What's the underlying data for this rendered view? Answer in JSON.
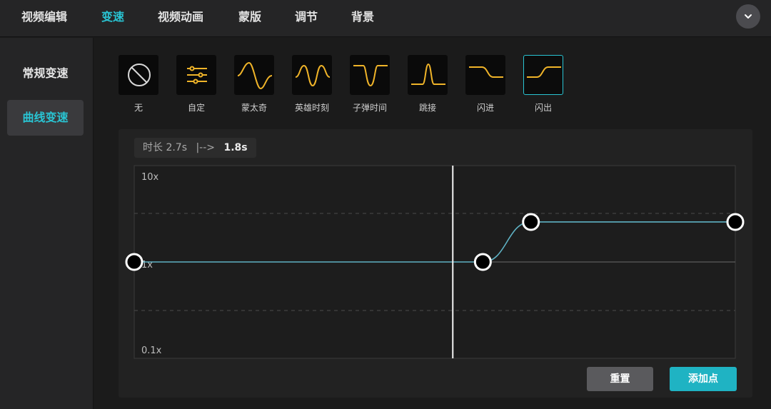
{
  "tabs": [
    {
      "label": "视频编辑",
      "active": false
    },
    {
      "label": "变速",
      "active": true
    },
    {
      "label": "视频动画",
      "active": false
    },
    {
      "label": "蒙版",
      "active": false
    },
    {
      "label": "调节",
      "active": false
    },
    {
      "label": "背景",
      "active": false
    }
  ],
  "collapse_icon": "chevron-down-icon",
  "sidebar": {
    "items": [
      {
        "label": "常规变速",
        "active": false
      },
      {
        "label": "曲线变速",
        "active": true
      }
    ]
  },
  "presets": [
    {
      "label": "无",
      "icon": "none-icon",
      "selected": false
    },
    {
      "label": "自定",
      "icon": "sliders-icon",
      "selected": false
    },
    {
      "label": "蒙太奇",
      "icon": "montage-curve-icon",
      "selected": false
    },
    {
      "label": "英雄时刻",
      "icon": "hero-moment-curve-icon",
      "selected": false
    },
    {
      "label": "子弹时间",
      "icon": "bullet-time-curve-icon",
      "selected": false
    },
    {
      "label": "跳接",
      "icon": "jump-cut-curve-icon",
      "selected": false
    },
    {
      "label": "闪进",
      "icon": "flash-in-curve-icon",
      "selected": false
    },
    {
      "label": "闪出",
      "icon": "flash-out-curve-icon",
      "selected": true
    }
  ],
  "editor": {
    "duration_prefix": "时长",
    "duration_original": "2.7s",
    "duration_arrow": "|-->",
    "duration_new": "1.8s",
    "y_axis": {
      "top_label": "10x",
      "middle_label": "1x",
      "bottom_label": "0.1x",
      "scale": "log"
    },
    "curve_points": [
      {
        "t": 0.0,
        "speed": 1.0
      },
      {
        "t": 0.58,
        "speed": 1.0
      },
      {
        "t": 0.66,
        "speed": 2.6
      },
      {
        "t": 1.0,
        "speed": 2.6
      }
    ],
    "playhead_t": 0.53,
    "reset_label": "重置",
    "add_point_label": "添加点"
  },
  "colors": {
    "accent": "#29c4d3",
    "preset_curve": "#f0b429",
    "speed_curve": "#5fb2c4",
    "button_primary": "#1fb3c3",
    "button_secondary": "#5a5a5d"
  }
}
